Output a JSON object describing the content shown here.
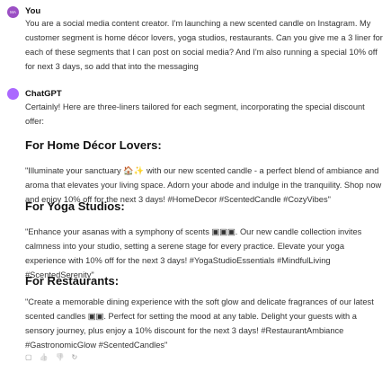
{
  "user": {
    "initials": "MA",
    "name": "You",
    "message": "You are a social media content creator. I'm launching a new scented candle on Instagram. My customer segment is home décor lovers, yoga studios, restaurants. Can you give me a 3 liner for each of these segments that I can post on social media? And I'm also running a special 10% off for next 3 days, so add that into the messaging",
    "avatar_color": "#9b4fc4"
  },
  "assistant": {
    "name": "ChatGPT",
    "avatar_color": "#ab68ff",
    "intro": "Certainly! Here are three-liners tailored for each segment, incorporating the special discount offer:",
    "sections": [
      {
        "heading": "For Home Décor Lovers:",
        "text": "\"Illuminate your sanctuary 🏠✨ with our new scented candle - a perfect blend of ambiance and aroma that elevates your living space. Adorn your abode and indulge in the tranquility. Shop now and enjoy 10% off for the next 3 days! #HomeDecor #ScentedCandle #CozyVibes\""
      },
      {
        "heading": "For Yoga Studios:",
        "text": "\"Enhance your asanas with a symphony of scents ▣▣▣. Our new candle collection invites calmness into your studio, setting a serene stage for every practice. Elevate your yoga experience with 10% off for the next 3 days! #YogaStudioEssentials #MindfulLiving #ScentedSerenity\""
      },
      {
        "heading": "For Restaurants:",
        "text": "\"Create a memorable dining experience with the soft glow and delicate fragrances of our latest scented candles ▣▣. Perfect for setting the mood at any table. Delight your guests with a sensory journey, plus enjoy a 10% discount for the next 3 days! #RestaurantAmbiance #GastronomicGlow #ScentedCandles\""
      }
    ]
  },
  "actions": [
    {
      "icon": "copy-icon",
      "glyph": "▢"
    },
    {
      "icon": "thumbs-up-icon",
      "glyph": "👍"
    },
    {
      "icon": "thumbs-down-icon",
      "glyph": "👎"
    },
    {
      "icon": "regenerate-icon",
      "glyph": "↻"
    }
  ]
}
